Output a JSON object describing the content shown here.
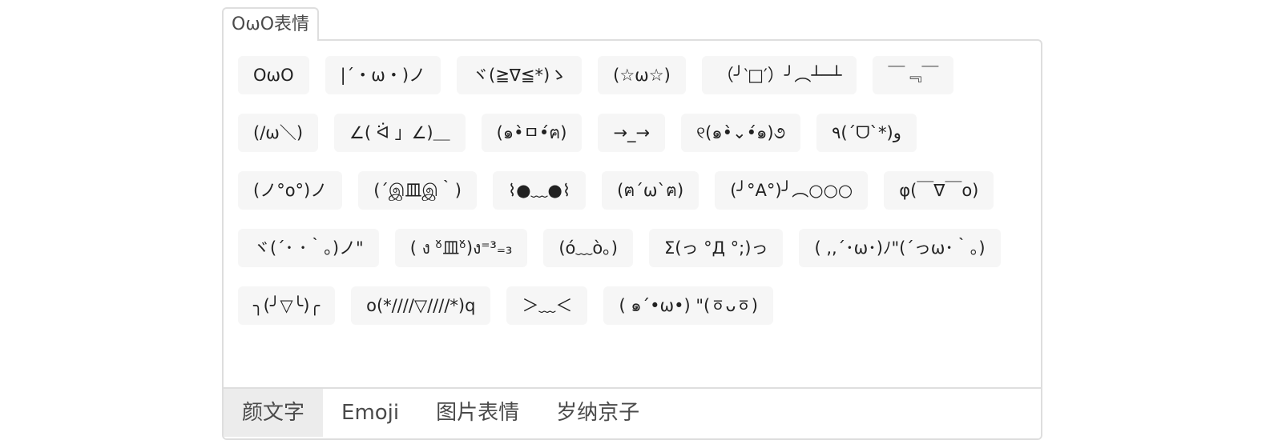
{
  "widget": {
    "title": "OωO表情"
  },
  "emoticons": [
    "OωO",
    "|´・ω・)ノ",
    "ヾ(≧∇≦*)ゝ",
    "(☆ω☆)",
    "（╯‵□′）╯︵┴─┴",
    "￣﹃￣",
    "(/ω＼)",
    "∠( ᐛ 」∠)＿",
    "(๑•̀ㅁ•́ฅ)",
    "→_→",
    "୧(๑•̀⌄•́๑)૭",
    "٩(ˊᗜˋ*)و",
    "(ノ°ο°)ノ",
    "(´இ皿இ｀)",
    "⌇●﹏●⌇",
    "(ฅ´ω`ฅ)",
    "(╯°A°)╯︵○○○",
    "φ(￣∇￣o)",
    "ヾ(´･ ･｀｡)ノ\"",
    "( ง ᵒ̌皿ᵒ̌)ง⁼³₌₃",
    "(ó﹏ò｡)",
    "Σ(っ °Д °;)っ",
    "( ,,´･ω･)ﾉ\"(´っω･｀｡)",
    "╮(╯▽╰)╭",
    "o(*////▽////*)q",
    "＞﹏＜",
    "( ๑´•ω•) \"(ㆆᴗㆆ)"
  ],
  "tabs": [
    {
      "label": "颜文字",
      "active": true
    },
    {
      "label": "Emoji",
      "active": false
    },
    {
      "label": "图片表情",
      "active": false
    },
    {
      "label": "岁纳京子",
      "active": false
    }
  ]
}
